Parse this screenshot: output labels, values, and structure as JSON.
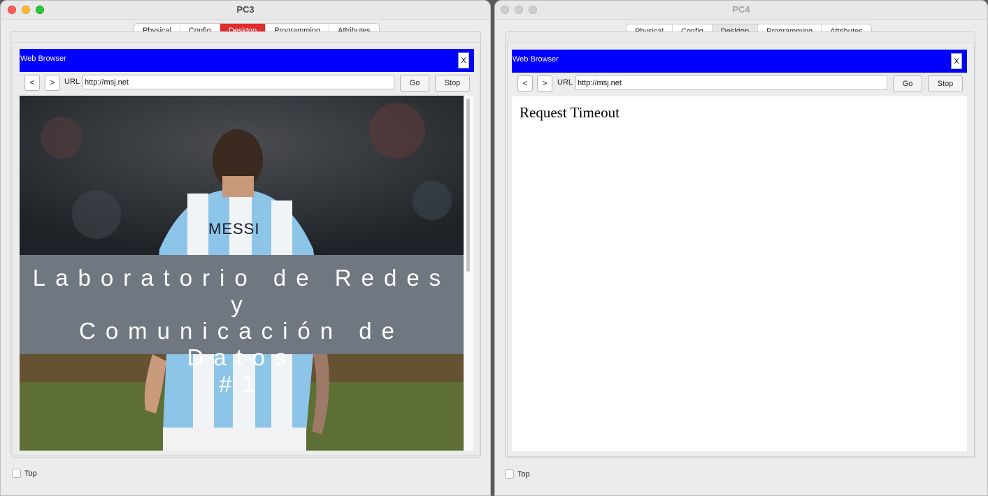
{
  "pc3": {
    "title": "PC3",
    "tabs": [
      "Physical",
      "Config",
      "Desktop",
      "Programming",
      "Attributes"
    ],
    "active_tab": "Desktop",
    "browser": {
      "title": "Web Browser",
      "close_label": "X",
      "back_label": "<",
      "forward_label": ">",
      "url_label": "URL",
      "url_value": "http://msj.net",
      "go_label": "Go",
      "stop_label": "Stop"
    },
    "page": {
      "photo_jersey_text": "MESSI",
      "banner_line1": "Laboratorio de Redes y",
      "banner_line2": "Comunicación de Datos",
      "banner_line3": "#1"
    },
    "top_label": "Top"
  },
  "pc4": {
    "title": "PC4",
    "tabs": [
      "Physical",
      "Config",
      "Desktop",
      "Programming",
      "Attributes"
    ],
    "active_tab": "Desktop",
    "browser": {
      "title": "Web Browser",
      "close_label": "X",
      "back_label": "<",
      "forward_label": ">",
      "url_label": "URL",
      "url_value": "http://msj.net",
      "go_label": "Go",
      "stop_label": "Stop"
    },
    "page": {
      "message": "Request Timeout"
    },
    "top_label": "Top"
  },
  "colors": {
    "browser_bar": "#0000ff",
    "active_tab_focused": "#e02c2c",
    "banner_overlay": "#6f7880"
  }
}
